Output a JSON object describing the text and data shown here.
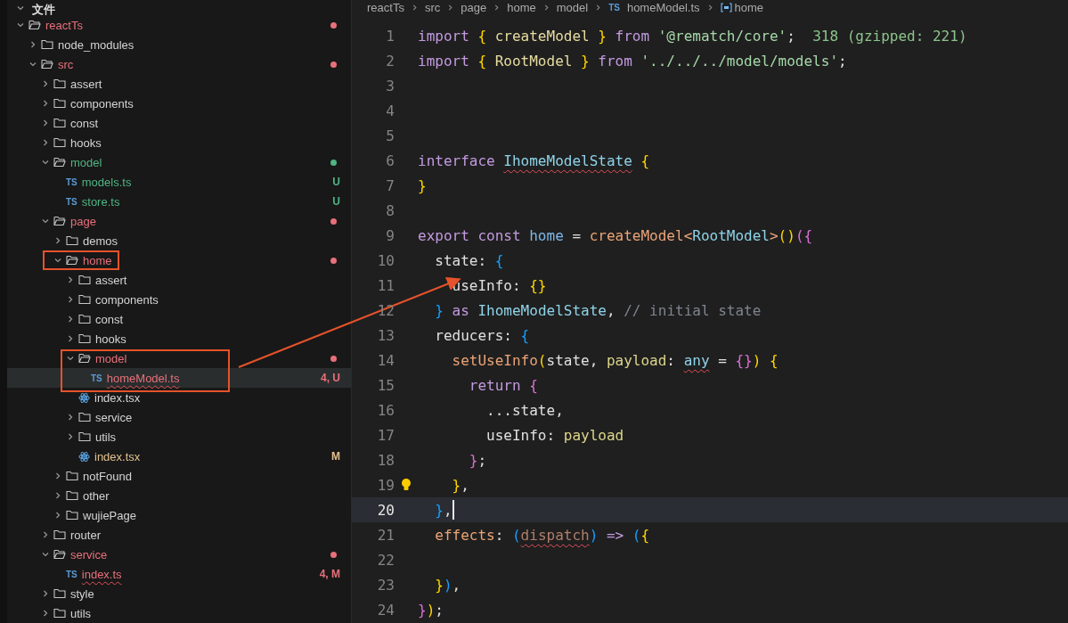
{
  "explorer": {
    "title": "文件",
    "expanded": true,
    "tree": [
      {
        "name": "reactTs",
        "kind": "folder",
        "expanded": true,
        "color": "#e8707b",
        "selected": false,
        "children": [
          {
            "name": "node_modules",
            "kind": "folder",
            "expanded": false,
            "selected": false
          },
          {
            "name": "src",
            "kind": "folder",
            "expanded": true,
            "color": "#e8707b",
            "selected": false,
            "children": [
              {
                "name": "assert",
                "kind": "folder",
                "expanded": false,
                "selected": false
              },
              {
                "name": "components",
                "kind": "folder",
                "expanded": false,
                "selected": false
              },
              {
                "name": "const",
                "kind": "folder",
                "expanded": false,
                "selected": false
              },
              {
                "name": "hooks",
                "kind": "folder",
                "expanded": false,
                "selected": false
              },
              {
                "name": "model",
                "kind": "folder",
                "expanded": true,
                "color": "#4fb583",
                "selected": false,
                "children": [
                  {
                    "name": "models.ts",
                    "kind": "ts",
                    "icon_label": "TS",
                    "color": "#4fb583",
                    "decoration": "U",
                    "selected": false
                  },
                  {
                    "name": "store.ts",
                    "kind": "ts",
                    "icon_label": "TS",
                    "color": "#4fb583",
                    "decoration": "U",
                    "selected": false
                  }
                ]
              },
              {
                "name": "page",
                "kind": "folder",
                "expanded": true,
                "color": "#e8707b",
                "selected": false,
                "children": [
                  {
                    "name": "demos",
                    "kind": "folder",
                    "expanded": false,
                    "selected": false
                  },
                  {
                    "name": "home",
                    "kind": "folder",
                    "expanded": true,
                    "color": "#e8707b",
                    "boxed": true,
                    "selected": false,
                    "children": [
                      {
                        "name": "assert",
                        "kind": "folder",
                        "expanded": false,
                        "selected": false
                      },
                      {
                        "name": "components",
                        "kind": "folder",
                        "expanded": false,
                        "selected": false
                      },
                      {
                        "name": "const",
                        "kind": "folder",
                        "expanded": false,
                        "selected": false
                      },
                      {
                        "name": "hooks",
                        "kind": "folder",
                        "expanded": false,
                        "selected": false
                      },
                      {
                        "name": "model",
                        "kind": "folder",
                        "expanded": true,
                        "color": "#e8707b",
                        "box_start": true,
                        "selected": false,
                        "children": [
                          {
                            "name": "homeModel.ts",
                            "kind": "ts",
                            "icon_label": "TS",
                            "color": "#e8707b",
                            "decoration": "4, U",
                            "squiggle": true,
                            "box_end": true,
                            "selected": true
                          }
                        ]
                      },
                      {
                        "name": "index.tsx",
                        "kind": "react",
                        "selected": false
                      },
                      {
                        "name": "service",
                        "kind": "folder",
                        "expanded": false,
                        "selected": false
                      },
                      {
                        "name": "utils",
                        "kind": "folder",
                        "expanded": false,
                        "selected": false
                      },
                      {
                        "name": "index.tsx",
                        "kind": "react",
                        "color": "#e2c08d",
                        "decoration": "M",
                        "selected": false
                      }
                    ]
                  },
                  {
                    "name": "notFound",
                    "kind": "folder",
                    "expanded": false,
                    "selected": false
                  },
                  {
                    "name": "other",
                    "kind": "folder",
                    "expanded": false,
                    "selected": false
                  },
                  {
                    "name": "wujiePage",
                    "kind": "folder",
                    "expanded": false,
                    "selected": false
                  }
                ]
              },
              {
                "name": "router",
                "kind": "folder",
                "expanded": false,
                "selected": false
              },
              {
                "name": "service",
                "kind": "folder",
                "expanded": true,
                "color": "#e8707b",
                "selected": false,
                "children": [
                  {
                    "name": "index.ts",
                    "kind": "ts",
                    "icon_label": "TS",
                    "color": "#e8707b",
                    "decoration": "4, M",
                    "squiggle": true,
                    "selected": false
                  }
                ]
              },
              {
                "name": "style",
                "kind": "folder",
                "expanded": false,
                "selected": false
              },
              {
                "name": "utils",
                "kind": "folder",
                "expanded": false,
                "selected": false
              }
            ]
          }
        ]
      }
    ]
  },
  "breadcrumbs": [
    {
      "label": "reactTs",
      "kind": "folder"
    },
    {
      "label": "src",
      "kind": "folder"
    },
    {
      "label": "page",
      "kind": "folder"
    },
    {
      "label": "home",
      "kind": "folder"
    },
    {
      "label": "model",
      "kind": "folder"
    },
    {
      "label": "homeModel.ts",
      "kind": "ts",
      "icon_label": "TS"
    },
    {
      "label": "home",
      "kind": "symbol"
    }
  ],
  "editor": {
    "lines": [
      {
        "number": "1",
        "current": false,
        "tokens": [
          {
            "text": "import",
            "kind": "keyword"
          },
          {
            "text": " {",
            "kind": "gold"
          },
          {
            "text": " createModel",
            "kind": "name"
          },
          {
            "text": " }",
            "kind": "gold"
          },
          {
            "text": " from",
            "kind": "keyword"
          },
          {
            "text": " '@rematch/core'",
            "kind": "string"
          },
          {
            "text": ";",
            "kind": "plain"
          },
          {
            "text": "  318 (gzipped: 221)",
            "kind": "hint"
          }
        ]
      },
      {
        "number": "2",
        "current": false,
        "tokens": [
          {
            "text": "import",
            "kind": "keyword"
          },
          {
            "text": " {",
            "kind": "gold"
          },
          {
            "text": " RootModel",
            "kind": "name"
          },
          {
            "text": " }",
            "kind": "gold"
          },
          {
            "text": " from",
            "kind": "keyword"
          },
          {
            "text": " '../../../model/models'",
            "kind": "string"
          },
          {
            "text": ";",
            "kind": "plain"
          }
        ]
      },
      {
        "number": "3",
        "current": false
      },
      {
        "number": "4",
        "current": false
      },
      {
        "number": "5",
        "current": false
      },
      {
        "number": "6",
        "current": false,
        "tokens": [
          {
            "text": "interface ",
            "kind": "keyword"
          },
          {
            "text": "IhomeModelState",
            "kind": "type",
            "error": true
          },
          {
            "text": " {",
            "kind": "gold"
          }
        ]
      },
      {
        "number": "7",
        "current": false,
        "tokens": [
          {
            "text": "}",
            "kind": "gold"
          }
        ]
      },
      {
        "number": "8",
        "current": false
      },
      {
        "number": "9",
        "current": false,
        "tokens": [
          {
            "text": "export",
            "kind": "keyword"
          },
          {
            "text": " const",
            "kind": "keyword"
          },
          {
            "text": " home",
            "kind": "variable"
          },
          {
            "text": " =",
            "kind": "plain"
          },
          {
            "text": " createModel<",
            "kind": "function"
          },
          {
            "text": "RootModel",
            "kind": "type"
          },
          {
            "text": ">",
            "kind": "function"
          },
          {
            "text": "()",
            "kind": "gold"
          },
          {
            "text": "({",
            "kind": "pink"
          }
        ]
      },
      {
        "number": "10",
        "current": false,
        "tokens": [
          {
            "text": "  state:",
            "kind": "plain"
          },
          {
            "text": " {",
            "kind": "blue"
          }
        ]
      },
      {
        "number": "11",
        "current": false,
        "tokens": [
          {
            "text": "    useInfo:",
            "kind": "plain"
          },
          {
            "text": " {}",
            "kind": "gold"
          }
        ]
      },
      {
        "number": "12",
        "current": false,
        "tokens": [
          {
            "text": "  }",
            "kind": "blue"
          },
          {
            "text": " as",
            "kind": "keyword"
          },
          {
            "text": " IhomeModelState",
            "kind": "type"
          },
          {
            "text": ",",
            "kind": "plain"
          },
          {
            "text": " // initial state",
            "kind": "comment"
          }
        ]
      },
      {
        "number": "13",
        "current": false,
        "tokens": [
          {
            "text": "  reducers:",
            "kind": "plain"
          },
          {
            "text": " {",
            "kind": "blue"
          }
        ]
      },
      {
        "number": "14",
        "current": false,
        "tokens": [
          {
            "text": "    setUseInfo",
            "kind": "function"
          },
          {
            "text": "(",
            "kind": "gold"
          },
          {
            "text": "state,",
            "kind": "plain"
          },
          {
            "text": " payload",
            "kind": "param"
          },
          {
            "text": ": ",
            "kind": "plain"
          },
          {
            "text": "any",
            "kind": "type",
            "error": true
          },
          {
            "text": " =",
            "kind": "plain"
          },
          {
            "text": " {}",
            "kind": "pink"
          },
          {
            "text": ")",
            "kind": "gold"
          },
          {
            "text": " {",
            "kind": "gold"
          }
        ]
      },
      {
        "number": "15",
        "current": false,
        "tokens": [
          {
            "text": "      return",
            "kind": "keyword"
          },
          {
            "text": " {",
            "kind": "pink"
          }
        ]
      },
      {
        "number": "16",
        "current": false,
        "tokens": [
          {
            "text": "        ...state,",
            "kind": "plain"
          }
        ]
      },
      {
        "number": "17",
        "current": false,
        "tokens": [
          {
            "text": "        useInfo:",
            "kind": "plain"
          },
          {
            "text": " payload",
            "kind": "param"
          }
        ]
      },
      {
        "number": "18",
        "current": false,
        "tokens": [
          {
            "text": "      }",
            "kind": "pink"
          },
          {
            "text": ";",
            "kind": "plain"
          }
        ]
      },
      {
        "number": "19",
        "current": false,
        "lightbulb": true,
        "tokens": [
          {
            "text": "    }",
            "kind": "gold"
          },
          {
            "text": ",",
            "kind": "plain"
          }
        ]
      },
      {
        "number": "20",
        "current": true,
        "tokens": [
          {
            "text": "  }",
            "kind": "blue"
          },
          {
            "text": ",",
            "kind": "plain"
          }
        ]
      },
      {
        "number": "21",
        "current": false,
        "tokens": [
          {
            "text": "  effects",
            "kind": "function"
          },
          {
            "text": ":",
            "kind": "plain"
          },
          {
            "text": " (",
            "kind": "blue"
          },
          {
            "text": "dispatch",
            "kind": "unused",
            "error": true
          },
          {
            "text": ")",
            "kind": "blue"
          },
          {
            "text": " =>",
            "kind": "keyword"
          },
          {
            "text": " (",
            "kind": "blue"
          },
          {
            "text": "{",
            "kind": "gold"
          }
        ]
      },
      {
        "number": "22",
        "current": false
      },
      {
        "number": "23",
        "current": false,
        "tokens": [
          {
            "text": "  }",
            "kind": "gold"
          },
          {
            "text": ")",
            "kind": "blue"
          },
          {
            "text": ",",
            "kind": "plain"
          }
        ]
      },
      {
        "number": "24",
        "current": false,
        "tokens": [
          {
            "text": "}",
            "kind": "pink"
          },
          {
            "text": ")",
            "kind": "gold"
          },
          {
            "text": ";",
            "kind": "plain"
          }
        ]
      }
    ]
  }
}
